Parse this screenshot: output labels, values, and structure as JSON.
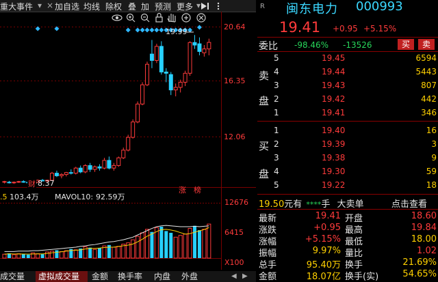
{
  "toolbar": {
    "items": [
      "重大事件",
      "加自选",
      "均线",
      "除权",
      "叠",
      "加",
      "预测",
      "更多"
    ],
    "chevron": "▾",
    "close": "×",
    "dropdown": "▾"
  },
  "chart_labels": {
    "max_price": "19.99",
    "min_price": "8.37",
    "badge_cai": "财",
    "badge_zhang": "涨",
    "badge_bang": "榜",
    "vol_line_prefix": ".5",
    "vol_value": "103.4万",
    "mavol_label": "MAVOL10:",
    "mavol_value": "92.59万",
    "vol_axis": [
      "12676",
      "6415",
      "X100"
    ],
    "price_axis": [
      "20.64",
      "16.35",
      "12.06"
    ]
  },
  "chart_data": {
    "type": "candlestick",
    "price_axis_ticks": [
      20.64,
      16.35,
      12.06
    ],
    "ylim": [
      8.0,
      21.0
    ],
    "candles": [
      {
        "o": 8.5,
        "h": 8.6,
        "l": 8.4,
        "c": 8.55
      },
      {
        "o": 8.5,
        "h": 8.6,
        "l": 8.4,
        "c": 8.45
      },
      {
        "o": 8.45,
        "h": 8.55,
        "l": 8.37,
        "c": 8.5
      },
      {
        "o": 8.5,
        "h": 8.6,
        "l": 8.45,
        "c": 8.55
      },
      {
        "o": 8.55,
        "h": 8.65,
        "l": 8.45,
        "c": 8.5
      },
      {
        "o": 8.5,
        "h": 8.6,
        "l": 8.4,
        "c": 8.45
      },
      {
        "o": 8.45,
        "h": 8.55,
        "l": 8.37,
        "c": 8.5
      },
      {
        "o": 8.5,
        "h": 8.7,
        "l": 8.45,
        "c": 8.65
      },
      {
        "o": 8.65,
        "h": 8.75,
        "l": 8.55,
        "c": 8.6
      },
      {
        "o": 8.6,
        "h": 8.7,
        "l": 8.5,
        "c": 8.65
      },
      {
        "o": 8.65,
        "h": 9.3,
        "l": 8.6,
        "c": 9.2
      },
      {
        "o": 9.2,
        "h": 9.4,
        "l": 8.9,
        "c": 9.0
      },
      {
        "o": 9.0,
        "h": 9.2,
        "l": 8.8,
        "c": 9.1
      },
      {
        "o": 9.1,
        "h": 9.3,
        "l": 8.95,
        "c": 9.25
      },
      {
        "o": 9.25,
        "h": 9.5,
        "l": 9.1,
        "c": 9.2
      },
      {
        "o": 9.2,
        "h": 9.7,
        "l": 9.1,
        "c": 9.6
      },
      {
        "o": 9.6,
        "h": 9.8,
        "l": 9.2,
        "c": 9.3
      },
      {
        "o": 9.3,
        "h": 9.9,
        "l": 9.2,
        "c": 9.8
      },
      {
        "o": 9.8,
        "h": 10.0,
        "l": 9.3,
        "c": 9.5
      },
      {
        "o": 9.5,
        "h": 9.8,
        "l": 9.3,
        "c": 9.7
      },
      {
        "o": 9.7,
        "h": 9.9,
        "l": 9.4,
        "c": 9.6
      },
      {
        "o": 9.6,
        "h": 10.4,
        "l": 9.5,
        "c": 10.2
      },
      {
        "o": 10.2,
        "h": 10.5,
        "l": 9.5,
        "c": 9.6
      },
      {
        "o": 9.6,
        "h": 10.0,
        "l": 9.4,
        "c": 9.8
      },
      {
        "o": 9.8,
        "h": 10.5,
        "l": 9.7,
        "c": 10.4
      },
      {
        "o": 10.4,
        "h": 11.2,
        "l": 10.3,
        "c": 11.0
      },
      {
        "o": 11.0,
        "h": 12.2,
        "l": 10.9,
        "c": 12.0
      },
      {
        "o": 12.0,
        "h": 13.4,
        "l": 11.9,
        "c": 13.2
      },
      {
        "o": 13.2,
        "h": 14.8,
        "l": 13.1,
        "c": 14.6
      },
      {
        "o": 14.6,
        "h": 16.3,
        "l": 14.5,
        "c": 16.1
      },
      {
        "o": 16.1,
        "h": 17.9,
        "l": 16.0,
        "c": 17.7
      },
      {
        "o": 18.5,
        "h": 19.6,
        "l": 17.4,
        "c": 18.0
      },
      {
        "o": 18.0,
        "h": 19.3,
        "l": 17.8,
        "c": 19.1
      },
      {
        "o": 19.1,
        "h": 19.5,
        "l": 16.9,
        "c": 17.1
      },
      {
        "o": 17.1,
        "h": 17.4,
        "l": 16.3,
        "c": 17.0
      },
      {
        "o": 16.9,
        "h": 17.1,
        "l": 15.3,
        "c": 15.7
      },
      {
        "o": 15.7,
        "h": 16.2,
        "l": 15.2,
        "c": 15.9
      },
      {
        "o": 15.9,
        "h": 16.5,
        "l": 15.5,
        "c": 16.3
      },
      {
        "o": 16.3,
        "h": 17.2,
        "l": 16.0,
        "c": 17.0
      },
      {
        "o": 17.0,
        "h": 19.5,
        "l": 16.8,
        "c": 19.4
      },
      {
        "o": 19.4,
        "h": 19.99,
        "l": 18.9,
        "c": 19.2
      },
      {
        "o": 19.3,
        "h": 19.8,
        "l": 18.4,
        "c": 18.7
      },
      {
        "o": 18.6,
        "h": 19.2,
        "l": 18.3,
        "c": 18.9
      },
      {
        "o": 18.9,
        "h": 19.7,
        "l": 18.4,
        "c": 19.41
      }
    ],
    "volume": [
      9,
      11,
      8,
      10,
      9,
      8,
      12,
      10,
      9,
      14,
      16,
      18,
      15,
      17,
      21,
      19,
      22,
      26,
      24,
      20,
      23,
      28,
      30,
      25,
      27,
      32,
      35,
      42,
      50,
      58,
      66,
      60,
      70,
      72,
      62,
      58,
      48,
      52,
      55,
      68,
      74,
      64,
      66,
      78
    ],
    "volume_max": 126.76,
    "mavol10": [
      15,
      15,
      15,
      16,
      16,
      16,
      17,
      17,
      18,
      19,
      20,
      21,
      22,
      23,
      24,
      25,
      27,
      28,
      30,
      31,
      33,
      35,
      37,
      38,
      40,
      42,
      45,
      48,
      53,
      58,
      63,
      68,
      72,
      74,
      75,
      74,
      73,
      72,
      72,
      72,
      73,
      72,
      73,
      74
    ],
    "max_price": 19.99,
    "min_price": 8.37
  },
  "quote": {
    "code_label": "R",
    "name": "闽东电力",
    "code": "000993",
    "price": "19.41",
    "change": "+0.95",
    "change_pct": "+5.15%",
    "weibi_label": "委比",
    "weibi_value": "-98.46%",
    "weicha_value": "-13526",
    "buy_btn": "买",
    "sell_btn": "卖",
    "asks": [
      {
        "lvl": "5",
        "price": "19.45",
        "vol": "6594"
      },
      {
        "lvl": "4",
        "price": "19.44",
        "vol": "5443"
      },
      {
        "lvl": "3",
        "price": "19.43",
        "vol": "807"
      },
      {
        "lvl": "2",
        "price": "19.42",
        "vol": "442"
      },
      {
        "lvl": "1",
        "price": "19.41",
        "vol": "346"
      }
    ],
    "ask_labels": [
      "卖",
      "盘"
    ],
    "bids": [
      {
        "lvl": "1",
        "price": "19.40",
        "vol": "16"
      },
      {
        "lvl": "2",
        "price": "19.39",
        "vol": "3"
      },
      {
        "lvl": "3",
        "price": "19.38",
        "vol": "9"
      },
      {
        "lvl": "4",
        "price": "19.30",
        "vol": "59"
      },
      {
        "lvl": "5",
        "price": "19.22",
        "vol": "18"
      }
    ],
    "bid_labels": [
      "买",
      "盘"
    ],
    "big_order": {
      "price": "19.50",
      "unit": "元有",
      "stars": "****",
      "hand": "手",
      "label": "大卖单",
      "link": "点击查看"
    },
    "stats": [
      {
        "l1": "最新",
        "v1": "19.41",
        "c1": "red",
        "l2": "开盘",
        "v2": "18.60",
        "c2": "red"
      },
      {
        "l1": "涨跌",
        "v1": "+0.95",
        "c1": "red",
        "l2": "最高",
        "v2": "19.84",
        "c2": "red"
      },
      {
        "l1": "涨幅",
        "v1": "+5.15%",
        "c1": "red",
        "l2": "最低",
        "v2": "18.00",
        "c2": "yellow"
      },
      {
        "l1": "振幅",
        "v1": "9.97%",
        "c1": "yellow",
        "l2": "量比",
        "v2": "1.02",
        "c2": "red"
      },
      {
        "l1": "总手",
        "v1": "95.40万",
        "c1": "yellow",
        "l2": "换手",
        "v2": "21.69%",
        "c2": "yellow"
      },
      {
        "l1": "金额",
        "v1": "18.07亿",
        "c1": "yellow",
        "l2": "换手(实)",
        "v2": "54.65%",
        "c2": "yellow"
      }
    ]
  },
  "bottom_tabs": [
    "成交量",
    "虚拟成交量",
    "金额",
    "换手率",
    "内盘",
    "外盘"
  ],
  "bottom_nav": {
    "left": "◀",
    "right": "▶"
  },
  "colors": {
    "up": "#ff3b3b",
    "down": "#27d0ff",
    "bg": "#000000",
    "grid": "#7a0000",
    "ma": "#ffffff",
    "ma2": "#ffd100"
  }
}
